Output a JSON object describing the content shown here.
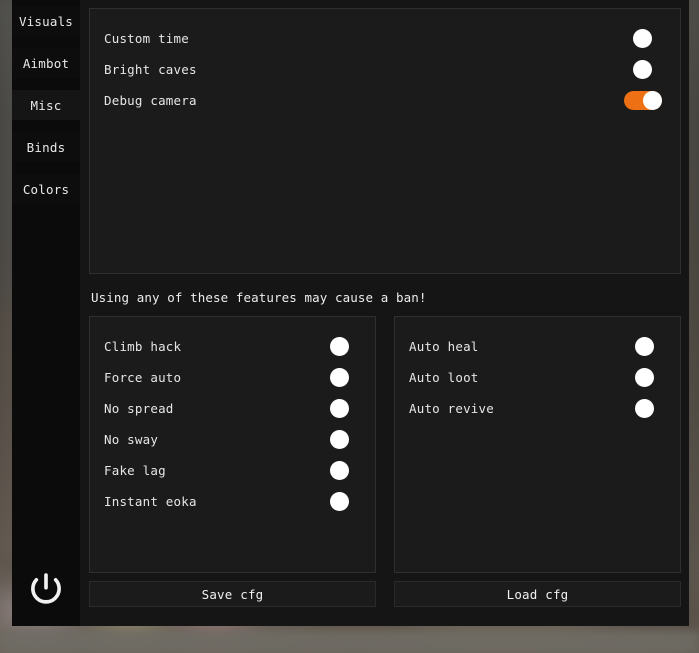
{
  "sidebar": {
    "tabs": [
      {
        "label": "Visuals",
        "active": false
      },
      {
        "label": "Aimbot",
        "active": false
      },
      {
        "label": "Misc",
        "active": true
      },
      {
        "label": "Binds",
        "active": false
      },
      {
        "label": "Colors",
        "active": false
      }
    ],
    "power_icon": "power-icon"
  },
  "top_panel": {
    "rows": [
      {
        "label": "Custom time",
        "state": "off"
      },
      {
        "label": "Bright caves",
        "state": "off"
      },
      {
        "label": "Debug camera",
        "state": "on"
      }
    ]
  },
  "warning": {
    "text": "Using any of these features may cause a ban!"
  },
  "left_panel": {
    "rows": [
      {
        "label": "Climb hack",
        "state": "off"
      },
      {
        "label": "Force auto",
        "state": "off"
      },
      {
        "label": "No spread",
        "state": "off"
      },
      {
        "label": "No sway",
        "state": "off"
      },
      {
        "label": "Fake lag",
        "state": "off"
      },
      {
        "label": "Instant eoka",
        "state": "off"
      }
    ]
  },
  "right_panel": {
    "rows": [
      {
        "label": "Auto heal",
        "state": "off"
      },
      {
        "label": "Auto loot",
        "state": "off"
      },
      {
        "label": "Auto revive",
        "state": "off"
      }
    ]
  },
  "footer": {
    "save_label": "Save cfg",
    "load_label": "Load cfg"
  },
  "colors": {
    "accent": "#ed7014",
    "knob": "#ffffff",
    "panel_bg": "#1b1b1b",
    "panel_border": "#2f2f2f",
    "window_bg": "#151515",
    "sidebar_bg": "#0b0b0b",
    "text": "#e6e6e6"
  }
}
